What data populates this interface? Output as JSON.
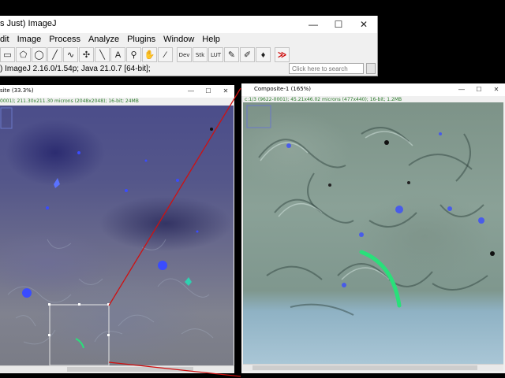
{
  "main_window": {
    "title": "s Just) ImageJ",
    "controls": {
      "minimize": "—",
      "maximize": "☐",
      "close": "✕"
    },
    "menu": [
      "dit",
      "Image",
      "Process",
      "Analyze",
      "Plugins",
      "Window",
      "Help"
    ],
    "tools": [
      {
        "name": "rectangle-tool",
        "glyph": "▭"
      },
      {
        "name": "polygon-tool",
        "glyph": "⬠"
      },
      {
        "name": "oval-tool",
        "glyph": "◯"
      },
      {
        "name": "line-tool",
        "glyph": "╱"
      },
      {
        "name": "freehand-tool",
        "glyph": "∿"
      },
      {
        "name": "multipoint-tool",
        "glyph": "✣"
      },
      {
        "name": "wand-tool",
        "glyph": "╲"
      },
      {
        "name": "text-tool",
        "glyph": "A"
      },
      {
        "name": "magnifier-tool",
        "glyph": "⚲"
      },
      {
        "name": "hand-tool",
        "glyph": "✋"
      },
      {
        "name": "color-picker-tool",
        "glyph": "⁄"
      }
    ],
    "extra_tools": [
      {
        "name": "dev-tool",
        "glyph": "Dev"
      },
      {
        "name": "stk-tool",
        "glyph": "Stk"
      },
      {
        "name": "lut-tool",
        "glyph": "LUT"
      },
      {
        "name": "pencil-tool",
        "glyph": "✎"
      },
      {
        "name": "brush-tool",
        "glyph": "✐"
      },
      {
        "name": "flood-fill-tool",
        "glyph": "♦"
      },
      {
        "name": "more-tools-button",
        "glyph": "≫"
      }
    ],
    "status": ") ImageJ 2.16.0/1.54p; Java 21.0.7 [64-bit];",
    "search_placeholder": "Click here to search"
  },
  "left_window": {
    "title": "site (33.3%)",
    "info": "0001); 211.30x211.30 microns (2048x2048); 16-bit; 24MB",
    "controls": {
      "minimize": "—",
      "maximize": "☐",
      "close": "✕"
    }
  },
  "right_window": {
    "title": "Composite-1 (165%)",
    "info": "c:1/3 (9622-0001); 45.21x46.02 microns (477x440); 16-bit; 1.2MB",
    "controls": {
      "minimize": "—",
      "maximize": "☐",
      "close": "✕"
    }
  },
  "colors": {
    "zoom_line": "#d01010",
    "roi_box": "#e6e6e6",
    "nucleus_blue": "#3a4cff",
    "fiber_green": "#29e07a"
  }
}
